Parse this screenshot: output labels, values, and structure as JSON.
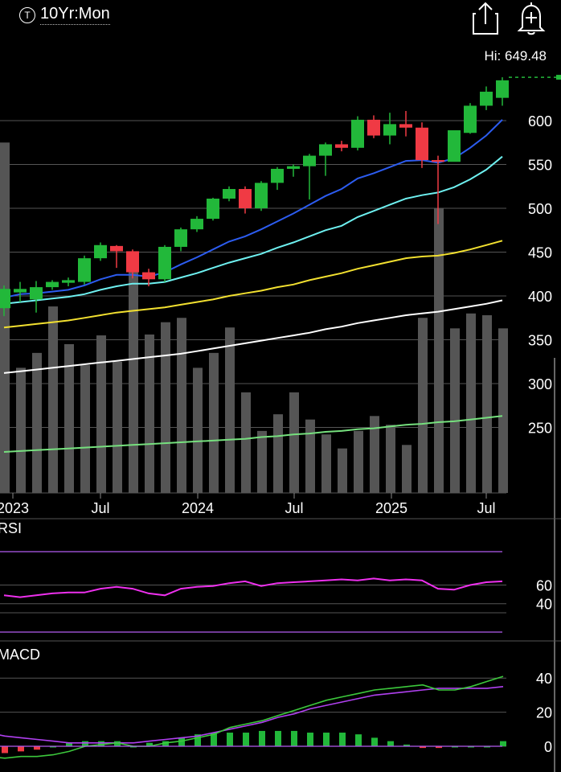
{
  "header": {
    "type_badge": "T",
    "timeframe": "10Yr:Mon"
  },
  "icons": {
    "share": "share-icon",
    "alert": "bell-plus-icon"
  },
  "hi_label": "Hi: 649.48",
  "colors": {
    "up": "#22b83a",
    "down": "#f03a44",
    "ema_fast": "#2c5cf0",
    "ema_mid": "#6ef0f0",
    "ema_slow": "#f2e030",
    "sma_long": "#ffffff",
    "sma_longer": "#76e07e",
    "rsi": "#ee30ee",
    "macd": "#3cc83c",
    "signal": "#b040f0",
    "volume": "#555555"
  },
  "chart_data": [
    {
      "type": "candlestick",
      "y_ticks": [
        "600",
        "550",
        "500",
        "450",
        "400",
        "350",
        "300",
        "250"
      ],
      "x_ticks": [
        "2023",
        "Jul",
        "2024",
        "Jul",
        "2025",
        "Jul"
      ],
      "hi": 649.48,
      "candles": [
        {
          "o": 386,
          "h": 412,
          "l": 377,
          "c": 408
        },
        {
          "o": 404,
          "h": 416,
          "l": 393,
          "c": 408
        },
        {
          "o": 396,
          "h": 417,
          "l": 381,
          "c": 410
        },
        {
          "o": 410,
          "h": 418,
          "l": 407,
          "c": 416
        },
        {
          "o": 415,
          "h": 421,
          "l": 411,
          "c": 418
        },
        {
          "o": 416,
          "h": 446,
          "l": 413,
          "c": 443
        },
        {
          "o": 443,
          "h": 461,
          "l": 440,
          "c": 458
        },
        {
          "o": 457,
          "h": 458,
          "l": 432,
          "c": 451
        },
        {
          "o": 451,
          "h": 453,
          "l": 420,
          "c": 427
        },
        {
          "o": 427,
          "h": 431,
          "l": 411,
          "c": 419
        },
        {
          "o": 419,
          "h": 458,
          "l": 416,
          "c": 456
        },
        {
          "o": 456,
          "h": 478,
          "l": 451,
          "c": 476
        },
        {
          "o": 476,
          "h": 491,
          "l": 473,
          "c": 488
        },
        {
          "o": 488,
          "h": 512,
          "l": 486,
          "c": 511
        },
        {
          "o": 511,
          "h": 525,
          "l": 508,
          "c": 522
        },
        {
          "o": 522,
          "h": 525,
          "l": 494,
          "c": 500
        },
        {
          "o": 500,
          "h": 531,
          "l": 497,
          "c": 529
        },
        {
          "o": 529,
          "h": 547,
          "l": 521,
          "c": 545
        },
        {
          "o": 545,
          "h": 550,
          "l": 536,
          "c": 548
        },
        {
          "o": 548,
          "h": 562,
          "l": 510,
          "c": 560
        },
        {
          "o": 560,
          "h": 575,
          "l": 537,
          "c": 573
        },
        {
          "o": 573,
          "h": 577,
          "l": 565,
          "c": 569
        },
        {
          "o": 569,
          "h": 605,
          "l": 566,
          "c": 601
        },
        {
          "o": 601,
          "h": 606,
          "l": 580,
          "c": 583
        },
        {
          "o": 583,
          "h": 609,
          "l": 573,
          "c": 596
        },
        {
          "o": 596,
          "h": 611,
          "l": 582,
          "c": 592
        },
        {
          "o": 592,
          "h": 598,
          "l": 546,
          "c": 555
        },
        {
          "o": 555,
          "h": 560,
          "l": 482,
          "c": 553
        },
        {
          "o": 553,
          "h": 589,
          "l": 555,
          "c": 589
        },
        {
          "o": 586,
          "h": 620,
          "l": 585,
          "c": 617
        },
        {
          "o": 617,
          "h": 639,
          "l": 612,
          "c": 633
        },
        {
          "o": 626,
          "h": 649.48,
          "l": 617,
          "c": 646
        }
      ],
      "ema_fast": [
        398,
        402,
        403,
        405,
        407,
        412,
        419,
        424,
        424,
        422,
        427,
        436,
        444,
        453,
        462,
        468,
        476,
        485,
        494,
        504,
        514,
        522,
        534,
        540,
        547,
        554,
        555,
        552,
        557,
        569,
        583,
        601
      ],
      "ema_mid": [
        391,
        393,
        395,
        397,
        399,
        402,
        407,
        411,
        414,
        414,
        416,
        421,
        426,
        432,
        438,
        443,
        448,
        455,
        461,
        468,
        475,
        480,
        490,
        497,
        504,
        511,
        515,
        518,
        524,
        533,
        544,
        559
      ],
      "ema_slow": [
        364,
        366,
        368,
        370,
        372,
        375,
        378,
        381,
        383,
        385,
        387,
        390,
        393,
        396,
        400,
        403,
        406,
        410,
        413,
        418,
        422,
        426,
        431,
        435,
        439,
        443,
        445,
        446,
        449,
        453,
        458,
        463
      ],
      "sma_long": [
        312,
        314,
        316,
        318,
        320,
        322,
        324,
        326,
        328,
        330,
        332,
        334,
        337,
        340,
        343,
        346,
        349,
        352,
        355,
        358,
        362,
        365,
        369,
        372,
        375,
        378,
        380,
        382,
        385,
        388,
        391,
        395
      ],
      "sma_longer": [
        222,
        223,
        224,
        225,
        226,
        227,
        228,
        229,
        230,
        231,
        232,
        233,
        234,
        235,
        236,
        237,
        239,
        240,
        242,
        243,
        245,
        246,
        248,
        249,
        251,
        253,
        254,
        256,
        257,
        259,
        261,
        263
      ],
      "volume": [
        358,
        362,
        575,
        318,
        335,
        388,
        345,
        321,
        355,
        325,
        450,
        356,
        370,
        375,
        318,
        335,
        364,
        290,
        246,
        265,
        290,
        259,
        242,
        226,
        246,
        263,
        253,
        230,
        375,
        500,
        363,
        380,
        378,
        363
      ]
    },
    {
      "type": "line",
      "title": "RSI",
      "y_ticks": [
        "60",
        "40"
      ],
      "values": [
        49,
        47,
        49,
        51,
        52,
        52,
        56,
        58,
        56,
        51,
        49,
        56,
        58,
        59,
        62,
        64,
        59,
        62,
        63,
        64,
        65,
        66,
        65,
        67,
        65,
        66,
        65,
        56,
        55,
        60,
        63,
        64
      ]
    },
    {
      "type": "line",
      "title": "MACD",
      "y_ticks": [
        "40",
        "20",
        "0"
      ],
      "macd": [
        -2,
        -6,
        -7,
        -6,
        -6,
        -5,
        -3,
        0,
        1,
        2,
        0,
        0,
        2,
        3,
        5,
        7,
        11,
        13,
        15,
        18,
        21,
        24,
        27,
        29,
        31,
        33,
        34,
        35,
        36,
        33,
        33,
        35,
        38,
        41
      ],
      "signal": [
        12,
        8,
        6,
        5,
        4,
        3,
        2,
        2,
        2,
        2,
        2,
        3,
        4,
        5,
        6,
        8,
        10,
        12,
        14,
        17,
        19,
        22,
        24,
        26,
        28,
        30,
        31,
        32,
        33,
        34,
        34,
        34,
        34,
        35
      ],
      "histogram": [
        -6,
        -5,
        -4,
        -3,
        -2,
        0,
        2,
        3,
        3,
        3,
        0,
        2,
        3,
        5,
        7,
        8,
        8,
        8,
        9,
        9,
        9,
        8,
        8,
        8,
        7,
        5,
        3,
        1,
        -1,
        -1,
        0,
        0,
        0,
        3
      ]
    }
  ]
}
